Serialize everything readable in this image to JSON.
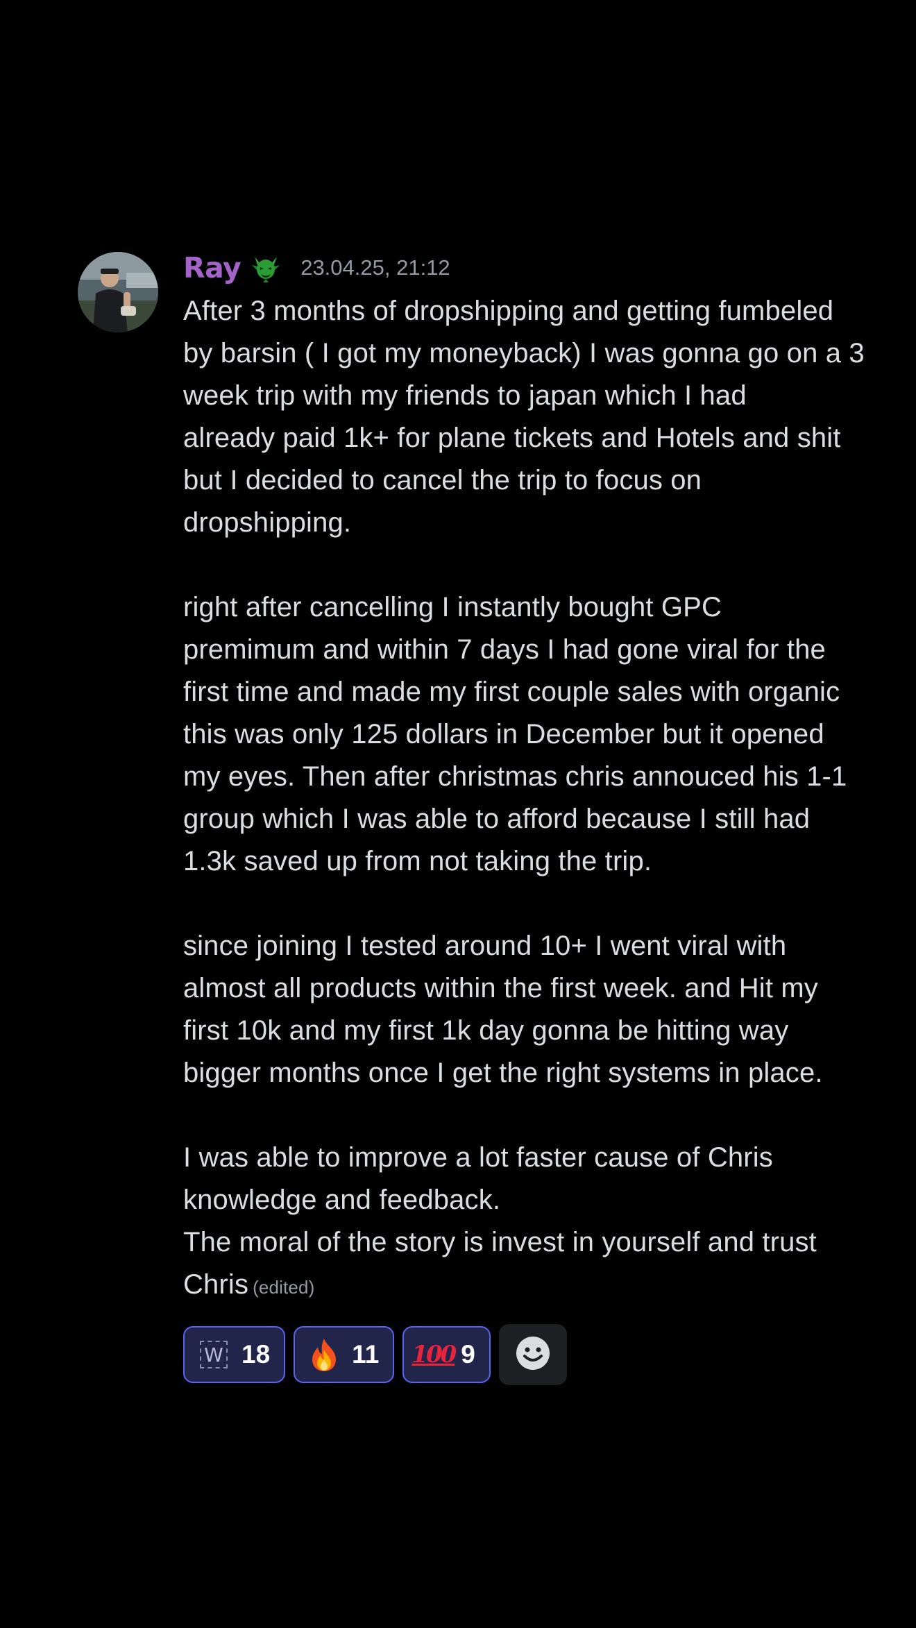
{
  "message": {
    "author": "Ray",
    "author_color": "#a463c9",
    "role_icon": "green-demon-icon",
    "timestamp": "23.04.25, 21:12",
    "body": "After 3 months of dropshipping and getting fumbeled\nby barsin ( I got my moneyback) I was gonna go on a 3\nweek trip with my friends to japan which I had\nalready paid 1k+ for plane tickets and Hotels and shit\nbut I decided to cancel the trip to focus on\ndropshipping.\n\nright after cancelling I instantly bought GPC\npremimum and within 7 days I had gone viral for the\nfirst time and made my first couple sales with organic\nthis was only 125 dollars in December but it opened\nmy eyes. Then after christmas chris annouced his 1-1\ngroup which I was able to afford because I still had\n1.3k saved up from not taking the trip.\n\nsince joining I tested around 10+ I went viral with\nalmost all products within the first week. and Hit my\nfirst 10k and my first 1k day gonna be hitting way\nbigger months once I get the right systems in place.\n\nI was able to improve a lot faster cause of Chris\nknowledge and feedback.\nThe moral of the story is invest in yourself and trust\nChris",
    "edited_label": "(edited)"
  },
  "reactions": [
    {
      "emoji": "w-custom-emoji",
      "glyph": "W",
      "count": "18"
    },
    {
      "emoji": "fire-emoji",
      "count": "11"
    },
    {
      "emoji": "hundred-points-emoji",
      "glyph": "100",
      "count": "9"
    }
  ],
  "add_reaction_icon": "smiley-add-reaction-icon",
  "colors": {
    "background": "#000000",
    "text": "#dbdee1",
    "muted": "#949ba4",
    "reaction_border": "#5865f2",
    "reaction_bg": "#22254a"
  }
}
